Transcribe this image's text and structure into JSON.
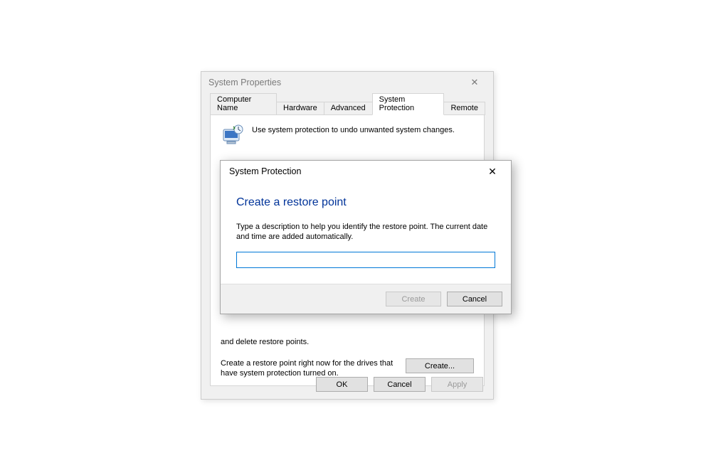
{
  "parent": {
    "title": "System Properties",
    "tabs": [
      "Computer Name",
      "Hardware",
      "Advanced",
      "System Protection",
      "Remote"
    ],
    "active_tab_index": 3,
    "intro_text": "Use system protection to undo unwanted system changes.",
    "delete_row_text": "and delete restore points.",
    "create_row_text": "Create a restore point right now for the drives that have system protection turned on.",
    "create_button": "Create...",
    "footer": {
      "ok": "OK",
      "cancel": "Cancel",
      "apply": "Apply"
    }
  },
  "dialog": {
    "title": "System Protection",
    "heading": "Create a restore point",
    "description": "Type a description to help you identify the restore point. The current date and time are added automatically.",
    "input_value": "",
    "buttons": {
      "create": "Create",
      "cancel": "Cancel"
    }
  }
}
